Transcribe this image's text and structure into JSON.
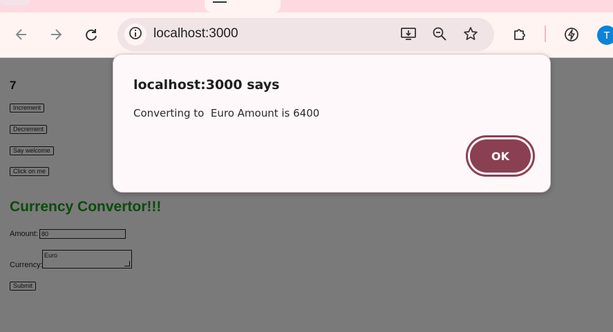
{
  "browser": {
    "url": "localhost:3000",
    "profile_initial": "T",
    "colors": {
      "tabstrip": "#ffd9e0",
      "toolbar": "#fff4f2",
      "omnibox": "#f0e4e6",
      "profile": "#0b83d9"
    }
  },
  "page": {
    "counter_value": "7",
    "buttons": {
      "increment": "Increment",
      "decrement": "Decrement",
      "say_welcome": "Say welcome",
      "click_me": "Click on me",
      "submit": "Submit"
    },
    "heading": "Currency Convertor!!!",
    "amount_label": "Amount:",
    "amount_value": "80",
    "currency_label": "Currency:",
    "currency_value": "Euro",
    "colors": {
      "heading": "#0d4a0d",
      "overlay_bg": "#7a7a7a"
    }
  },
  "dialog": {
    "title": "localhost:3000 says",
    "message": "Converting to  Euro Amount is 6400",
    "ok_label": "OK",
    "colors": {
      "ok_button": "#8a4051"
    }
  }
}
